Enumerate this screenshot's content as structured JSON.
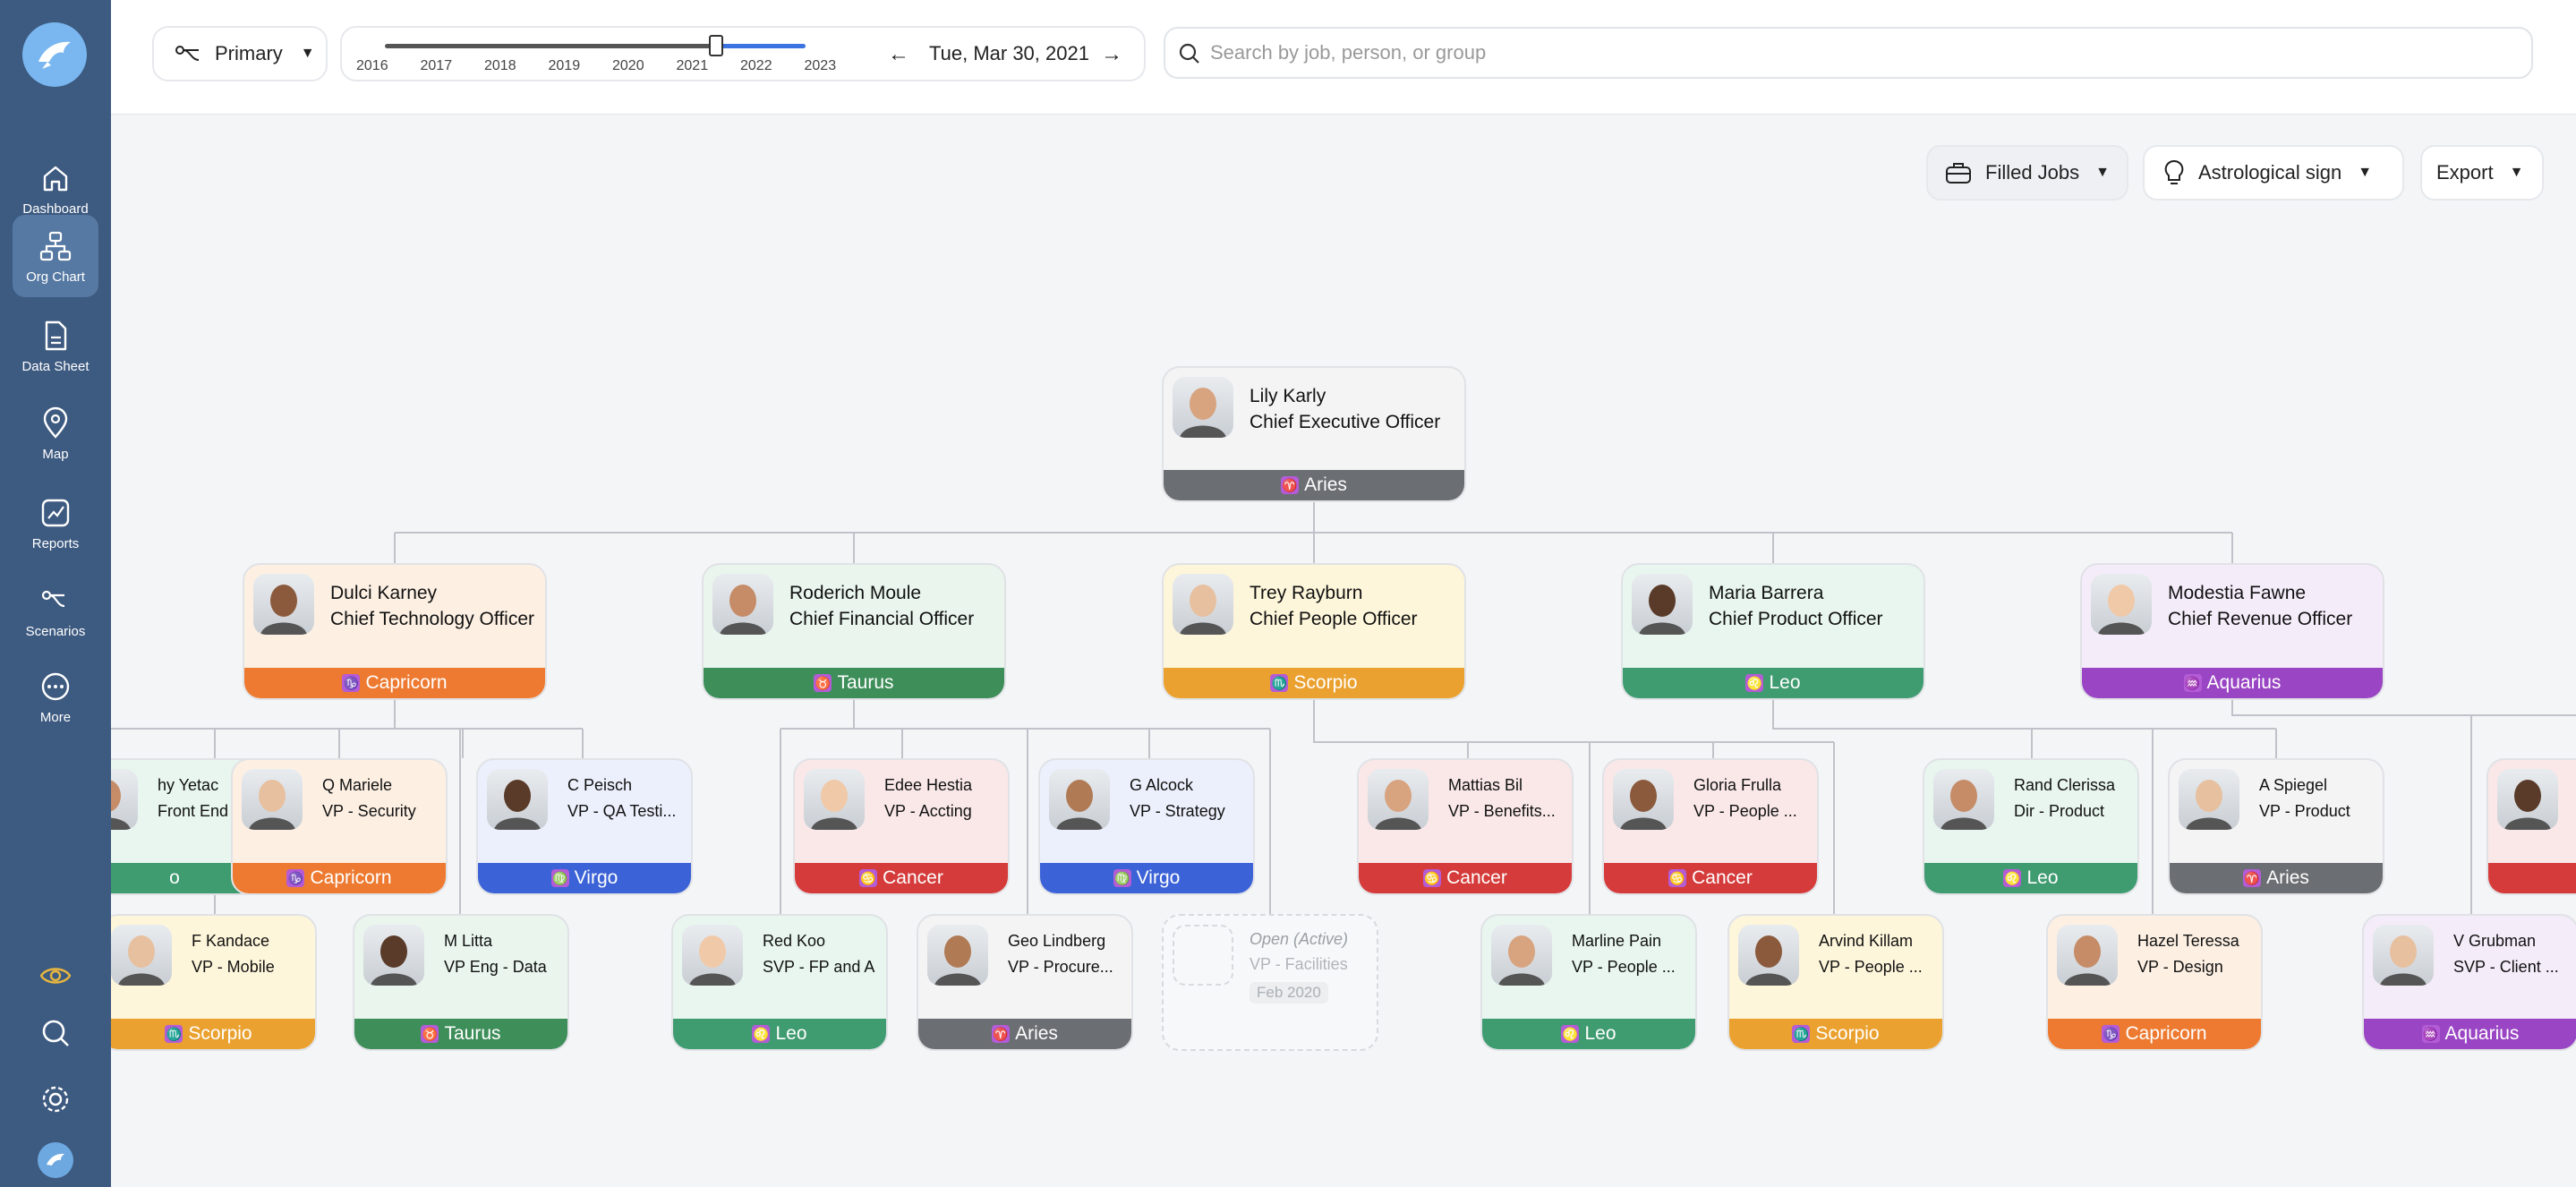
{
  "nav": {
    "items": [
      {
        "label": "Dashboard",
        "icon": "home-icon"
      },
      {
        "label": "Org Chart",
        "icon": "org-chart-icon"
      },
      {
        "label": "Data Sheet",
        "icon": "document-icon"
      },
      {
        "label": "Map",
        "icon": "map-pin-icon"
      },
      {
        "label": "Reports",
        "icon": "chart-icon"
      },
      {
        "label": "Scenarios",
        "icon": "scenarios-icon"
      },
      {
        "label": "More",
        "icon": "more-icon"
      }
    ]
  },
  "toolbar": {
    "scenario_label": "Primary",
    "years": [
      "2016",
      "2017",
      "2018",
      "2019",
      "2020",
      "2021",
      "2022",
      "2023"
    ],
    "date": "Tue, Mar 30, 2021",
    "search_placeholder": "Search by job, person, or group",
    "filled_jobs": "Filled Jobs",
    "astro": "Astrological sign",
    "export": "Export"
  },
  "colors": {
    "Aries": "#6b6e72",
    "Capricorn": "#ed7a30",
    "Taurus": "#3e8e5a",
    "Scorpio": "#eaa12f",
    "Leo": "#3f9b70",
    "Aquarius": "#9a45c4",
    "Virgo": "#3b62d6",
    "Cancer": "#d53b3b"
  },
  "org": {
    "ceo": {
      "name": "Lily Karly",
      "title": "Chief Executive Officer",
      "sign": "Aries"
    },
    "level1": [
      {
        "name": "Dulci Karney",
        "title": "Chief Technology Officer",
        "sign": "Capricorn"
      },
      {
        "name": "Roderich Moule",
        "title": "Chief Financial Officer",
        "sign": "Taurus"
      },
      {
        "name": "Trey Rayburn",
        "title": "Chief People Officer",
        "sign": "Scorpio"
      },
      {
        "name": "Maria Barrera",
        "title": "Chief Product Officer",
        "sign": "Leo"
      },
      {
        "name": "Modestia Fawne",
        "title": "Chief Revenue Officer",
        "sign": "Aquarius"
      }
    ],
    "level2": [
      {
        "name": "hy Yetac",
        "title": "Front End",
        "sign": "Leo",
        "band_text": "o"
      },
      {
        "name": "Q Mariele",
        "title": "VP - Security",
        "sign": "Capricorn"
      },
      {
        "name": "C Peisch",
        "title": "VP - QA Testi...",
        "sign": "Virgo"
      },
      {
        "name": "Edee Hestia",
        "title": "VP - Accting",
        "sign": "Cancer"
      },
      {
        "name": "G Alcock",
        "title": "VP - Strategy",
        "sign": "Virgo"
      },
      {
        "name": "Mattias Bil",
        "title": "VP - Benefits...",
        "sign": "Cancer"
      },
      {
        "name": "Gloria Frulla",
        "title": "VP - People ...",
        "sign": "Cancer"
      },
      {
        "name": "Rand Clerissa",
        "title": "Dir - Product",
        "sign": "Leo"
      },
      {
        "name": "A Spiegel",
        "title": "VP - Product",
        "sign": "Aries"
      },
      {
        "name": "",
        "title": "",
        "sign": "Cancer",
        "band_text": ""
      }
    ],
    "level3": [
      {
        "name": "F Kandace",
        "title": "VP - Mobile",
        "sign": "Scorpio"
      },
      {
        "name": "M Litta",
        "title": "VP Eng - Data",
        "sign": "Taurus"
      },
      {
        "name": "Red Koo",
        "title": "SVP - FP and A",
        "sign": "Leo"
      },
      {
        "name": "Geo Lindberg",
        "title": "VP - Procure...",
        "sign": "Aries"
      },
      {
        "name": "Marline Pain",
        "title": "VP - People ...",
        "sign": "Leo"
      },
      {
        "name": "Arvind Killam",
        "title": "VP - People ...",
        "sign": "Scorpio"
      },
      {
        "name": "Hazel Teressa",
        "title": "VP - Design",
        "sign": "Capricorn"
      },
      {
        "name": "V Grubman",
        "title": "SVP - Client ...",
        "sign": "Aquarius"
      }
    ],
    "open_job": {
      "status": "Open (Active)",
      "title": "VP - Facilities",
      "date": "Feb 2020"
    }
  }
}
